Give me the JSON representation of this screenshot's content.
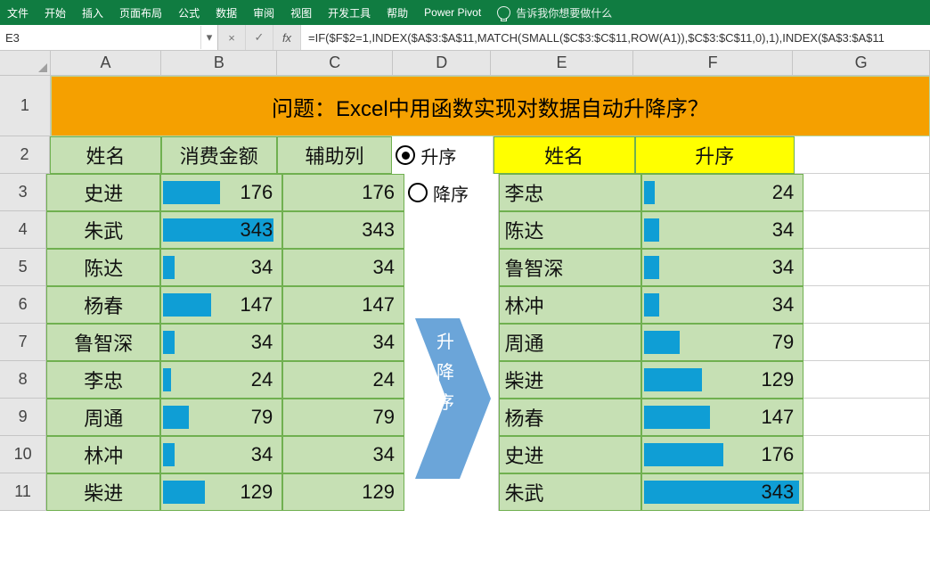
{
  "ribbon": {
    "tabs": [
      "文件",
      "开始",
      "插入",
      "页面布局",
      "公式",
      "数据",
      "审阅",
      "视图",
      "开发工具",
      "帮助",
      "Power Pivot"
    ],
    "tell_me": "告诉我你想要做什么"
  },
  "formula_bar": {
    "cell_ref": "E3",
    "formula": "=IF($F$2=1,INDEX($A$3:$A$11,MATCH(SMALL($C$3:$C$11,ROW(A1)),$C$3:$C$11,0),1),INDEX($A$3:$A$11"
  },
  "columns": [
    "A",
    "B",
    "C",
    "D",
    "E",
    "F",
    "G"
  ],
  "row_nums": [
    "1",
    "2",
    "3",
    "4",
    "5",
    "6",
    "7",
    "8",
    "9",
    "10",
    "11"
  ],
  "title": "问题：Excel中用函数实现对数据自动升降序？",
  "headers": {
    "A": "姓名",
    "B": "消费金额",
    "C": "辅助列",
    "E": "姓名",
    "F": "升序"
  },
  "radio": {
    "asc": "升序",
    "desc": "降序"
  },
  "left": [
    {
      "name": "史进",
      "b": 176,
      "c": 176
    },
    {
      "name": "朱武",
      "b": 343,
      "c": 343
    },
    {
      "name": "陈达",
      "b": 34,
      "c": 34
    },
    {
      "name": "杨春",
      "b": 147,
      "c": 147
    },
    {
      "name": "鲁智深",
      "b": 34,
      "c": 34
    },
    {
      "name": "李忠",
      "b": 24,
      "c": 24
    },
    {
      "name": "周通",
      "b": 79,
      "c": 79
    },
    {
      "name": "林冲",
      "b": 34,
      "c": 34
    },
    {
      "name": "柴进",
      "b": 129,
      "c": 129
    }
  ],
  "right": [
    {
      "name": "李忠",
      "v": 24
    },
    {
      "name": "陈达",
      "v": 34
    },
    {
      "name": "鲁智深",
      "v": 34
    },
    {
      "name": "林冲",
      "v": 34
    },
    {
      "name": "周通",
      "v": 79
    },
    {
      "name": "柴进",
      "v": 129
    },
    {
      "name": "杨春",
      "v": 147
    },
    {
      "name": "史进",
      "v": 176
    },
    {
      "name": "朱武",
      "v": 343
    }
  ],
  "bar_max": 343,
  "annotation": "升\n降\n序",
  "glyphs": {
    "times": "×",
    "check": "✓",
    "dd": "▾"
  }
}
